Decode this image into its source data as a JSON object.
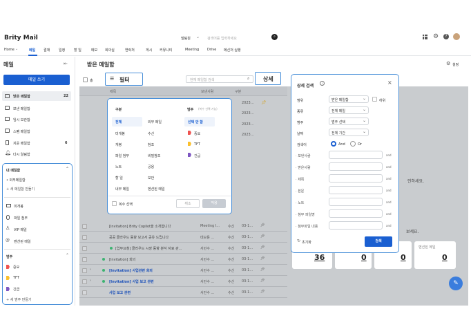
{
  "brand": {
    "name": "Brity Mail"
  },
  "topbar": {
    "user": "빌팀원",
    "search_placeholder": "검색어를 입력하세요"
  },
  "nav": [
    "Home",
    "메일",
    "결재",
    "일정",
    "할 일",
    "메모",
    "회의실",
    "연락처",
    "게시",
    "커뮤니티",
    "Meeting",
    "Drive",
    "메신저 실행"
  ],
  "sidebar": {
    "title": "메일",
    "compose": "메일 쓰기",
    "folders": [
      {
        "label": "받은 메일함",
        "count": "22"
      },
      {
        "label": "보낸 메일함",
        "count": ""
      },
      {
        "label": "임시 보관함",
        "count": ""
      },
      {
        "label": "스팸 메일함",
        "count": ""
      },
      {
        "label": "지운 메일함",
        "count": "6"
      },
      {
        "label": "다시 알림함",
        "count": ""
      }
    ],
    "my_title": "내 메일함",
    "my_items": [
      "외부메일함",
      "새 메일함 만들기"
    ],
    "filters": [
      "미개봉",
      "파일 첨부",
      "VIP 메일",
      "멘션된 메일"
    ],
    "cat_title": "범주",
    "cats": [
      {
        "label": "중요",
        "color": "#ef5350"
      },
      {
        "label": "TFT",
        "color": "#fbc02d"
      },
      {
        "label": "긴급",
        "color": "#7e57c2"
      }
    ],
    "new_cat": "새 범주 만들기"
  },
  "main": {
    "title": "받은 메일함",
    "settings": "설정",
    "list_search_placeholder": "현재 메일함 검색",
    "filter_label": "필터",
    "detail_label": "상세",
    "total_prefix": "총",
    "columns": [
      "제목",
      "보낸사람",
      "구분"
    ]
  },
  "filter_popup": {
    "col1_title": "구분",
    "col1": [
      "전체",
      "미개봉",
      "개봉",
      "파일 첨부",
      "노트",
      "할 일",
      "내부 메일"
    ],
    "col2": [
      "외부 메일",
      "수신",
      "참조",
      "비밀참조",
      "공용",
      "보안",
      "멘션된 메일"
    ],
    "col3_title": "범주",
    "col3_hint": "(복수 선택 가능)",
    "col3": [
      "선택 안 함",
      "중요",
      "TFT",
      "긴급"
    ],
    "multi": "복수 선택",
    "cancel": "취소",
    "apply": "적용"
  },
  "detail_popup": {
    "title": "상세 검색",
    "range_label": "범위",
    "range_value": "받은 메일함",
    "sub_label": "하위",
    "type_label": "종류",
    "type_value": "전체 메일",
    "cat_label": "범주",
    "cat_value": "범주 선택",
    "date_label": "날짜",
    "date_value": "전체 기간",
    "cond_label": "검색어",
    "and": "And",
    "or": "Or",
    "fields": [
      "보낸사람",
      "받은사람",
      "제목",
      "본문",
      "노트",
      "첨부 파일명",
      "첨부파일 내용"
    ],
    "and_word": "and",
    "reset": "초기화",
    "search": "검색"
  },
  "rows": [
    {
      "subject": "[Invitation] Brity Copilot을 소개합니다",
      "from": "Meeting I...",
      "kind": "수신",
      "date": "03-1..."
    },
    {
      "subject": "공공 클라우드 동향 보고서 공유 드립니다",
      "from": "데모용 ...",
      "kind": "수신",
      "date": "03-1..."
    },
    {
      "subject": "[업무요청] 클라우드 시장 동향 분석 자료 관...",
      "from": "서민수 ...",
      "kind": "수신",
      "date": "03-1..."
    },
    {
      "subject": "[Invitation] 회의",
      "from": "서민수 ...",
      "kind": "수신",
      "date": "03-1..."
    },
    {
      "subject": "[Invitation] 사업관련 회의",
      "from": "서민수 ...",
      "kind": "수신",
      "date": "03-1..."
    },
    {
      "subject": "[Invitation] 사업 보고 관련",
      "from": "서민수 ...",
      "kind": "수신",
      "date": "03-1..."
    },
    {
      "subject": "사업 보고 관련",
      "from": "서민수 ...",
      "kind": "수신",
      "date": "03-1..."
    }
  ],
  "year_cells": [
    "2023...",
    "2023...",
    "2023...",
    "2023..."
  ],
  "right_text": {
    "line1": "인하세요.",
    "line2": "보세요."
  },
  "stats": [
    {
      "label": "",
      "value": "36"
    },
    {
      "label": "",
      "value": "0"
    },
    {
      "label": "",
      "value": "0"
    },
    {
      "label": "멘션된 메일",
      "value": "0"
    }
  ]
}
